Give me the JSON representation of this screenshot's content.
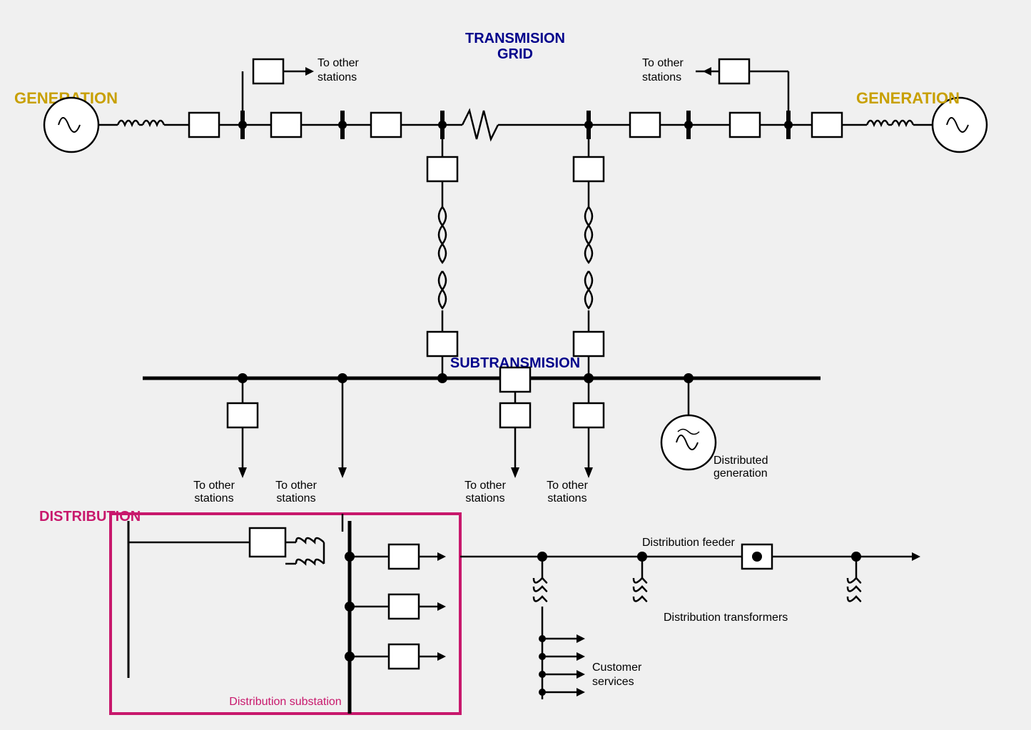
{
  "labels": {
    "generation_left": "GENERATION",
    "generation_right": "GENERATION",
    "transmission_grid_1": "TRANSMISION",
    "transmission_grid_2": "GRID",
    "subtransmission": "SUBTRANSMISION",
    "distribution": "DISTRIBUTION",
    "distribution_substation": "Distribution substation",
    "distribution_feeder": "Distribution feeder",
    "distribution_transformers": "Distribution transformers",
    "customer_services_1": "Customer",
    "customer_services_2": "services",
    "distributed_gen_1": "Distributed",
    "distributed_gen_2": "generation",
    "to_other_stations_1": "To other",
    "to_other_stations_2": "stations"
  },
  "colors": {
    "generation": "#c8a000",
    "grid": "#00008b",
    "distribution": "#c8186c",
    "substation_border": "#c8186c",
    "wire": "#000000",
    "background": "#f0f0f0"
  }
}
